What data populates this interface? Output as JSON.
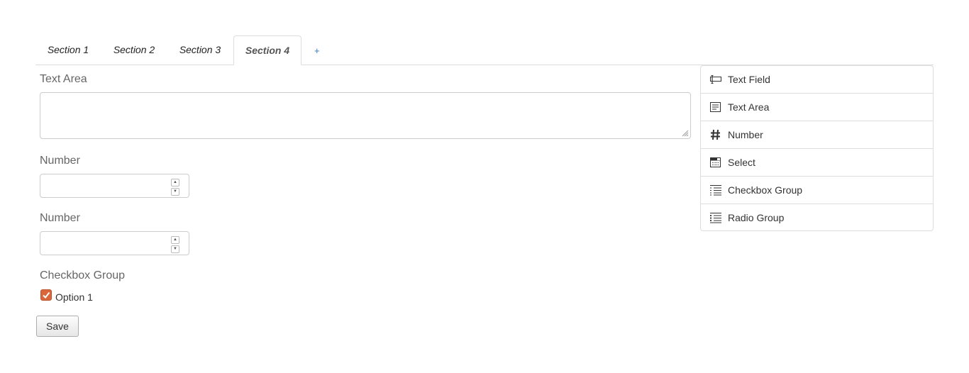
{
  "tabs": [
    {
      "label": "Section 1",
      "active": false
    },
    {
      "label": "Section 2",
      "active": false
    },
    {
      "label": "Section 3",
      "active": false
    },
    {
      "label": "Section 4",
      "active": true
    }
  ],
  "add_tab_label": "+",
  "form": {
    "textarea_label": "Text Area",
    "textarea_value": "",
    "number1_label": "Number",
    "number1_value": "",
    "number2_label": "Number",
    "number2_value": "",
    "checkbox_group_label": "Checkbox Group",
    "option1_label": "Option 1",
    "option1_checked": true,
    "save_label": "Save"
  },
  "palette": {
    "items": [
      {
        "label": "Text Field",
        "icon": "text-field-icon"
      },
      {
        "label": "Text Area",
        "icon": "text-area-icon"
      },
      {
        "label": "Number",
        "icon": "hash-icon"
      },
      {
        "label": "Select",
        "icon": "select-icon"
      },
      {
        "label": "Checkbox Group",
        "icon": "checkbox-list-icon"
      },
      {
        "label": "Radio Group",
        "icon": "radio-list-icon"
      }
    ]
  },
  "colors": {
    "checkbox_accent": "#d9673a",
    "link": "#337ab7"
  }
}
